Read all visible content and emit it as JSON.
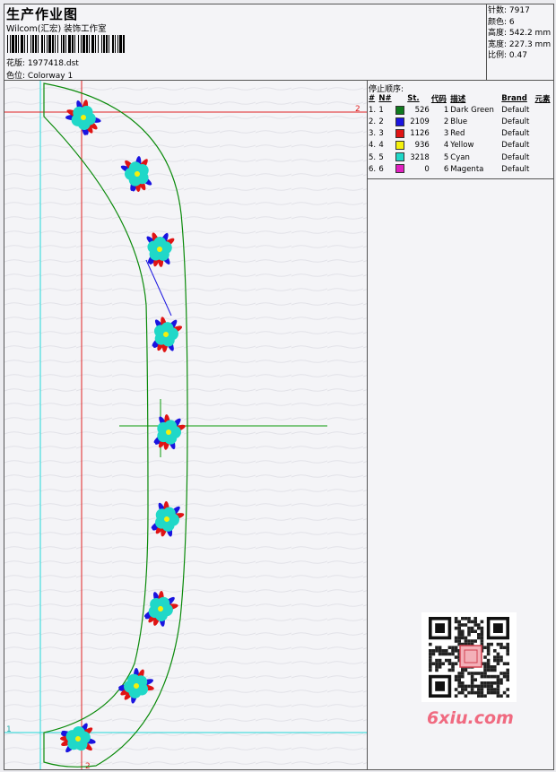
{
  "header": {
    "title": "生产作业图",
    "company": "Wilcom(汇宏) 装饰工作室",
    "design_label": "花版:",
    "design_value": "1977418.dst",
    "colorway_label": "色位:",
    "colorway_value": "Colorway 1"
  },
  "specs": [
    {
      "label": "针数:",
      "value": "7917"
    },
    {
      "label": "颜色:",
      "value": "6"
    },
    {
      "label": "高度:",
      "value": "542.2 mm"
    },
    {
      "label": "宽度:",
      "value": "227.3 mm"
    },
    {
      "label": "比例:",
      "value": "0.47"
    }
  ],
  "stop_sequence": {
    "title": "停止顺序:",
    "columns": [
      "#",
      "N#",
      "St.",
      "代码",
      "描述",
      "Brand",
      "元素"
    ],
    "rows": [
      {
        "idx": "1.",
        "n": "1",
        "color": "#0f7a1e",
        "st": "526",
        "code": "1",
        "desc": "Dark Green",
        "brand": "Default"
      },
      {
        "idx": "2.",
        "n": "2",
        "color": "#1a14e0",
        "st": "2109",
        "code": "2",
        "desc": "Blue",
        "brand": "Default"
      },
      {
        "idx": "3.",
        "n": "3",
        "color": "#e01414",
        "st": "1126",
        "code": "3",
        "desc": "Red",
        "brand": "Default"
      },
      {
        "idx": "4.",
        "n": "4",
        "color": "#f4f00c",
        "st": "936",
        "code": "4",
        "desc": "Yellow",
        "brand": "Default"
      },
      {
        "idx": "5.",
        "n": "5",
        "color": "#20d8c8",
        "st": "3218",
        "code": "5",
        "desc": "Cyan",
        "brand": "Default"
      },
      {
        "idx": "6.",
        "n": "6",
        "color": "#e020c0",
        "st": "0",
        "code": "6",
        "desc": "Magenta",
        "brand": "Default"
      }
    ]
  },
  "canvas": {
    "guide_label_top": "2",
    "guide_label_bottom": "2",
    "guide_label_left": "1"
  },
  "watermark": {
    "site": "6xiu.com"
  }
}
